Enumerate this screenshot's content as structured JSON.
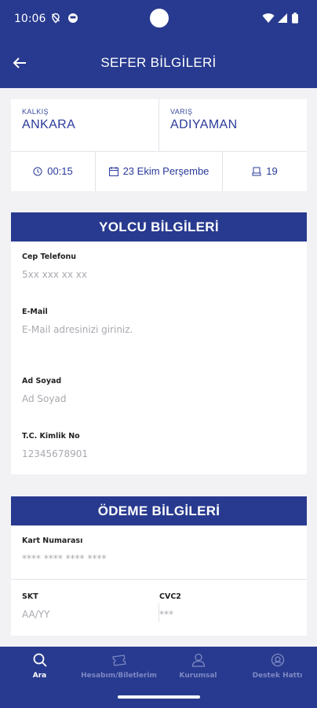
{
  "status_bar": {
    "time": "10:06"
  },
  "app_bar": {
    "title": "SEFER BİLGİLERİ",
    "back_icon": "arrow-left-icon"
  },
  "trip": {
    "departure_label": "KALKIŞ",
    "departure_city": "ANKARA",
    "arrival_label": "VARIŞ",
    "arrival_city": "ADIYAMAN",
    "time": "00:15",
    "date": "23 Ekim Perşembe",
    "seat": "19"
  },
  "passenger": {
    "header": "YOLCU BİLGİLERİ",
    "phone_label": "Cep Telefonu",
    "phone_placeholder": "5xx xxx xx xx",
    "email_label": "E-Mail",
    "email_placeholder": "E-Mail adresinizi giriniz.",
    "name_label": "Ad Soyad",
    "name_placeholder": "Ad Soyad",
    "tc_label": "T.C. Kimlik No",
    "tc_placeholder": "12345678901"
  },
  "payment": {
    "header": "ÖDEME BİLGİLERİ",
    "card_label": "Kart Numarası",
    "card_placeholder": "**** **** **** ****",
    "expiry_label": "SKT",
    "expiry_placeholder": "AA/YY",
    "cvc_label": "CVC2",
    "cvc_placeholder": "***"
  },
  "bottom_nav": [
    {
      "label": "Ara",
      "icon": "search-icon",
      "active": true
    },
    {
      "label": "Hesabım/Biletlerim",
      "icon": "ticket-icon",
      "active": false
    },
    {
      "label": "Kurumsal",
      "icon": "user-icon",
      "active": false
    },
    {
      "label": "Destek Hattı",
      "icon": "support-icon",
      "active": false
    }
  ],
  "colors": {
    "primary": "#283a8f",
    "background": "#f2f2f5",
    "card": "#ffffff"
  }
}
